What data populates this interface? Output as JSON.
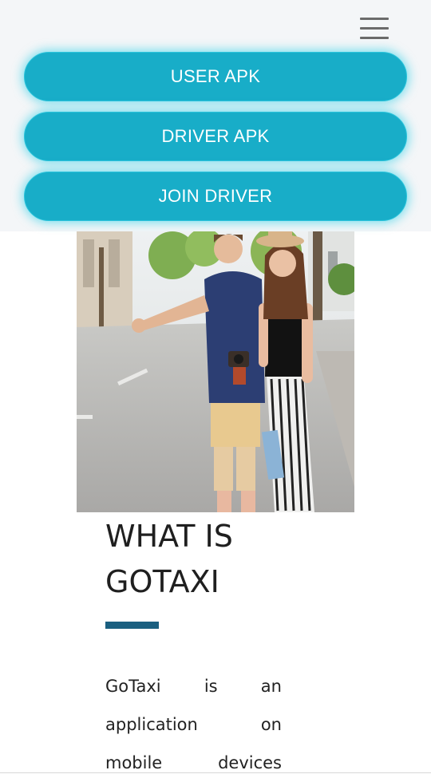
{
  "menu": {
    "toggle_icon": "hamburger-menu-icon",
    "buttons": [
      {
        "label": "USER APK"
      },
      {
        "label": "DRIVER APK"
      },
      {
        "label": "JOIN DRIVER"
      }
    ],
    "button_color": "#18adc8",
    "panel_color": "#f4f6f8"
  },
  "hero_image": {
    "subject": "young couple hitchhiking on a city street"
  },
  "about": {
    "heading_line1": "WHAT IS",
    "heading_line2": "GOTAXI",
    "accent_color": "#1a5f80",
    "lines": [
      [
        "GoTaxi",
        "is",
        "an"
      ],
      [
        "application",
        "on"
      ],
      [
        "mobile",
        "devices"
      ]
    ]
  }
}
